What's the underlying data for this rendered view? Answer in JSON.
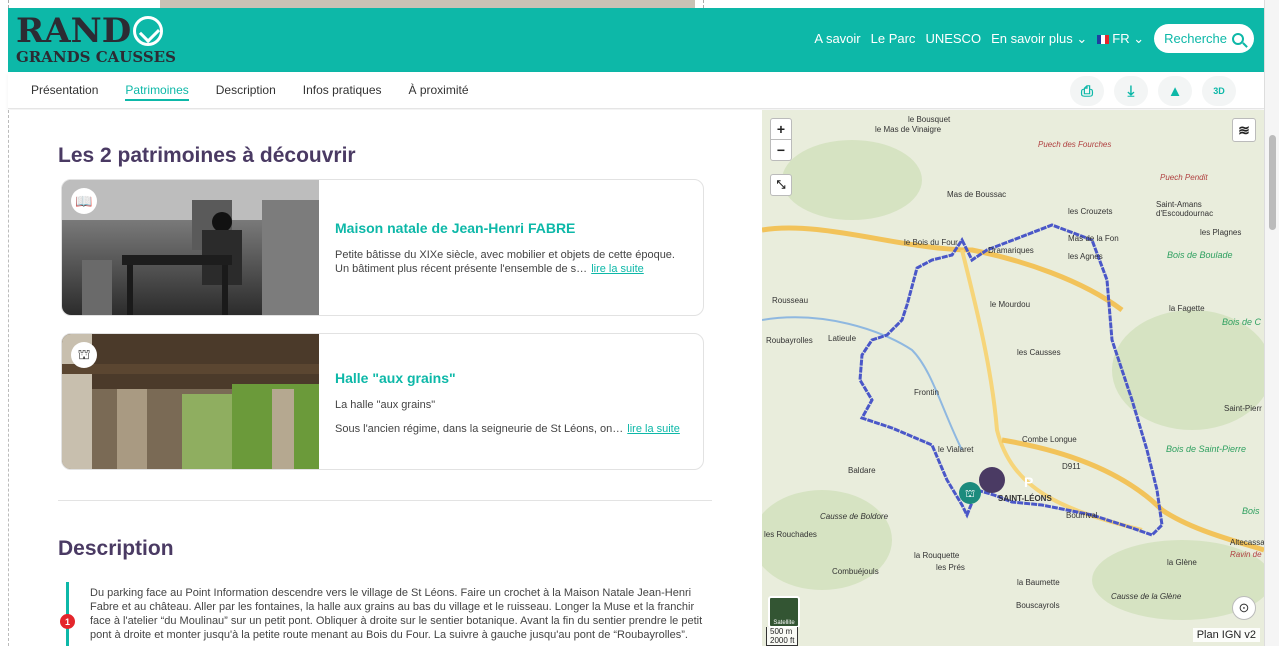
{
  "header": {
    "logo_main": "RAND",
    "logo_sub": "GRANDS CAUSSES",
    "nav": [
      "A savoir",
      "Le Parc",
      "UNESCO",
      "En savoir plus"
    ],
    "lang": "FR",
    "search_label": "Recherche"
  },
  "tabs": [
    "Présentation",
    "Patrimoines",
    "Description",
    "Infos pratiques",
    "À proximité"
  ],
  "patrimoines": {
    "heading": "Les 2 patrimoines à découvrir",
    "items": [
      {
        "title": "Maison natale de Jean-Henri FABRE",
        "text": "Petite bâtisse du XIXe siècle, avec mobilier et objets de cette époque. Un bâtiment plus récent présente l'ensemble de s…",
        "more": "lire la suite",
        "badge_icon": "book-icon"
      },
      {
        "title": "Halle \"aux grains\"",
        "subtitle": "La halle \"aux grains\"",
        "text": "Sous l'ancien régime, dans la seigneurie de St Léons, on…",
        "more": "lire la suite",
        "badge_icon": "arch-icon"
      }
    ]
  },
  "description": {
    "heading": "Description",
    "step": "1",
    "text": "Du parking face au Point Information descendre vers le village de St Léons. Faire un crochet à la Maison Natale Jean-Henri Fabre et au château. Aller par les fontaines, la halle aux grains au bas du village et le ruisseau. Longer la Muse et la franchir face à l'atelier “du Moulinau” sur un petit pont. Obliquer à droite sur le sentier botanique. Avant la fin du sentier prendre le petit pont à droite et monter jusqu'à la petite route menant au Bois du Four. La suivre à gauche jusqu'au pont de “Roubayrolles”."
  },
  "map": {
    "zoom_in": "+",
    "zoom_out": "−",
    "labels": [
      "le Bousquet",
      "le Mas de Vinaigre",
      "Puech des Fourches",
      "Mas de Boussac",
      "les Crouzets",
      "Saint-Amans d'Escoudournac",
      "Puech Pendit",
      "Mas de la Fon",
      "les Plagnes",
      "le Bois du Four",
      "Dramariques",
      "les Agnes",
      "Bois de Boulade",
      "Rousseau",
      "le Mourdou",
      "la Fagette",
      "Roubayrolles",
      "Latieule",
      "les Causses",
      "Frontin",
      "Bois de C",
      "Saint-Pierr",
      "le Vialaret",
      "Combe Longue",
      "Baldare",
      "Bois de Saint-Pierre",
      "D911",
      "SAINT-LÉONS",
      "Bourrival",
      "Causse de Boldore",
      "les Rouchades",
      "la Rouquette",
      "les Prés",
      "Altecassag",
      "Ravin de Fo",
      "la Glène",
      "Combuéjouls",
      "la Baumette",
      "Causse de la Glène",
      "Bouscayrols",
      "Bois"
    ],
    "satellite_label": "Satellite",
    "scale": "500 m",
    "scale2": "2000 ft",
    "layer_label": "Plan IGN v2"
  }
}
